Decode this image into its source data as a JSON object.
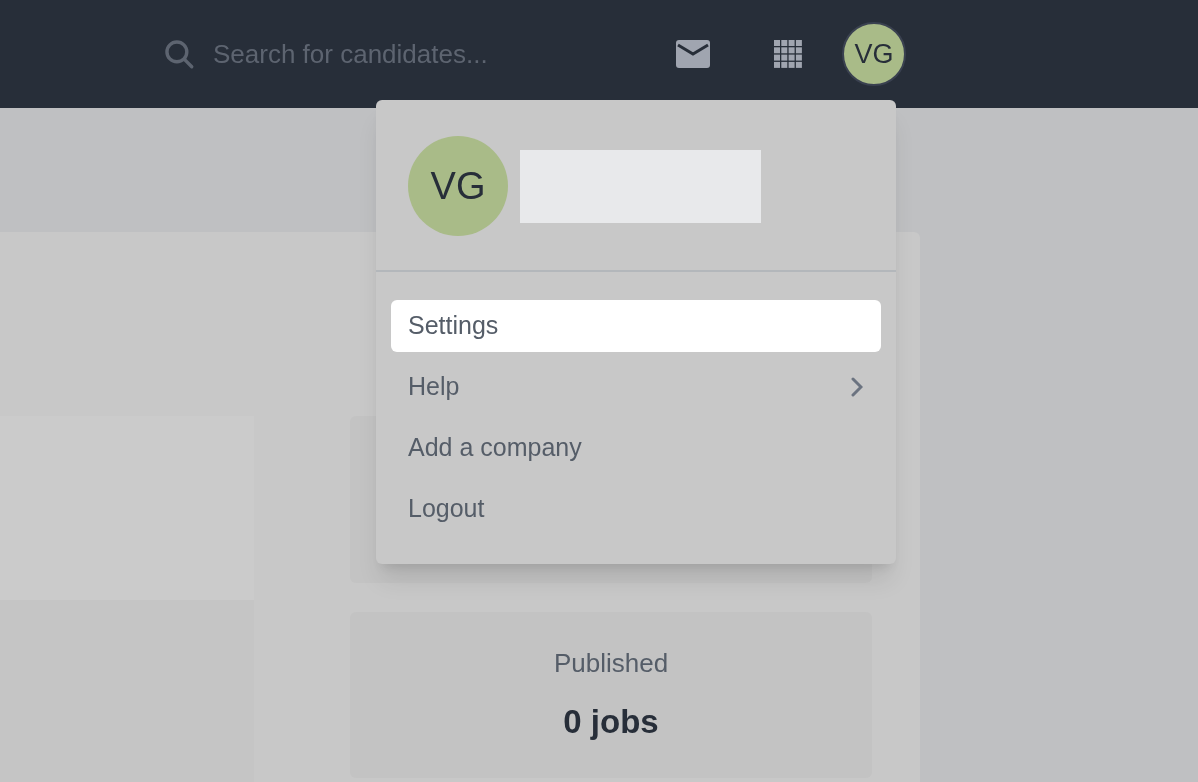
{
  "top_bar": {
    "search": {
      "placeholder": "Search for candidates..."
    },
    "avatar": {
      "initials": "VG"
    }
  },
  "user_menu": {
    "avatar": {
      "initials": "VG"
    },
    "items": [
      {
        "label": "Settings",
        "selected": true,
        "submenu": false
      },
      {
        "label": "Help",
        "selected": false,
        "submenu": true
      },
      {
        "label": "Add a company",
        "selected": false,
        "submenu": false
      },
      {
        "label": "Logout",
        "selected": false,
        "submenu": false
      }
    ]
  },
  "stats": [
    {
      "label": "Published",
      "value": "0 jobs"
    }
  ]
}
